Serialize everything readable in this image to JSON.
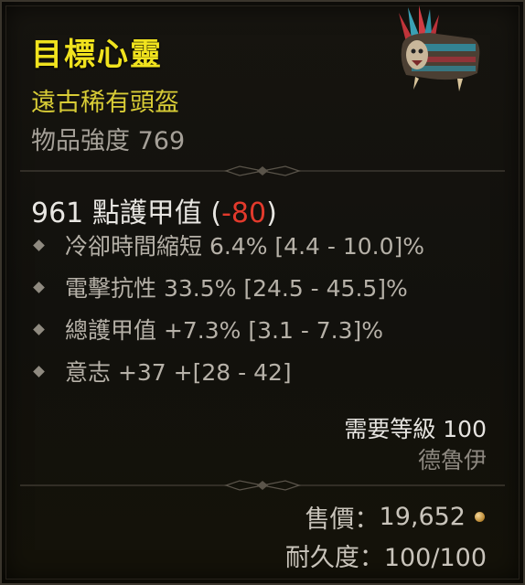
{
  "item": {
    "name": "目標心靈",
    "rarity": "遠古稀有頭盔",
    "power_label": "物品強度",
    "power_value": "769",
    "icon": "helmet-icon"
  },
  "armor": {
    "value": "961",
    "label": "點護甲值",
    "open": "(",
    "delta": "-80",
    "close": ")"
  },
  "affixes": [
    "冷卻時間縮短 6.4% [4.4 - 10.0]%",
    "電擊抗性 33.5% [24.5 - 45.5]%",
    "總護甲值 +7.3% [3.1 - 7.3]%",
    "意志 +37 +[28 - 42]"
  ],
  "requirements": {
    "level": "需要等級 100",
    "class": "德魯伊"
  },
  "sell": {
    "label": "售價：",
    "value": "19,652",
    "icon": "gold-coin-icon"
  },
  "durability": {
    "label": "耐久度：",
    "value": "100/100"
  },
  "colors": {
    "title": "#f0e21e",
    "rarity": "#d8cc36",
    "negative": "#e33a2c"
  }
}
